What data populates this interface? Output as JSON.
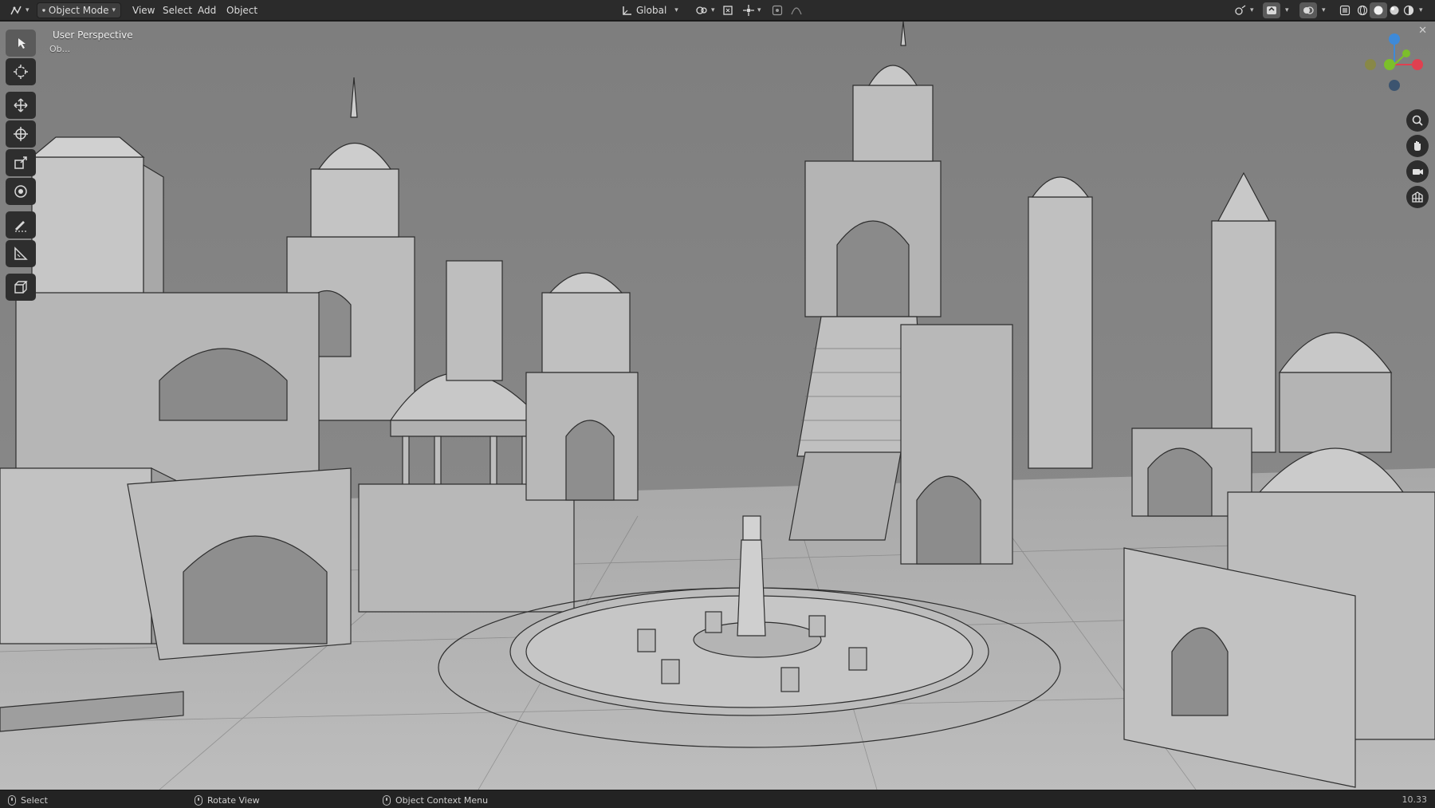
{
  "header": {
    "editor_type_icon": "3d-viewport-icon",
    "mode_label": "Object Mode",
    "menus": [
      "View",
      "Select",
      "Add",
      "Object"
    ],
    "orientation_label": "Global",
    "shading_modes": [
      "wireframe",
      "solid",
      "material-preview",
      "rendered"
    ],
    "active_shading": "solid"
  },
  "viewport": {
    "title": "User Perspective",
    "subtitle": "Ob...",
    "background_color": "#8a8a8a",
    "gizmo_axes": {
      "x": "#e04050",
      "y": "#7cbf2a",
      "z": "#3e8ad8"
    }
  },
  "toolbar": {
    "tools": [
      "select-box-icon",
      "cursor-icon",
      "move-icon",
      "rotate-icon",
      "scale-icon",
      "transform-icon",
      "annotate-icon",
      "measure-icon",
      "add-cube-icon"
    ],
    "active_tool": "select-box-icon"
  },
  "navigation": [
    "zoom-icon",
    "hand-pan-icon",
    "camera-icon",
    "grid-view-icon"
  ],
  "statusbar": {
    "select_label": "Select",
    "rotate_label": "Rotate View",
    "context_label": "Object Context Menu",
    "version": "10.33"
  }
}
